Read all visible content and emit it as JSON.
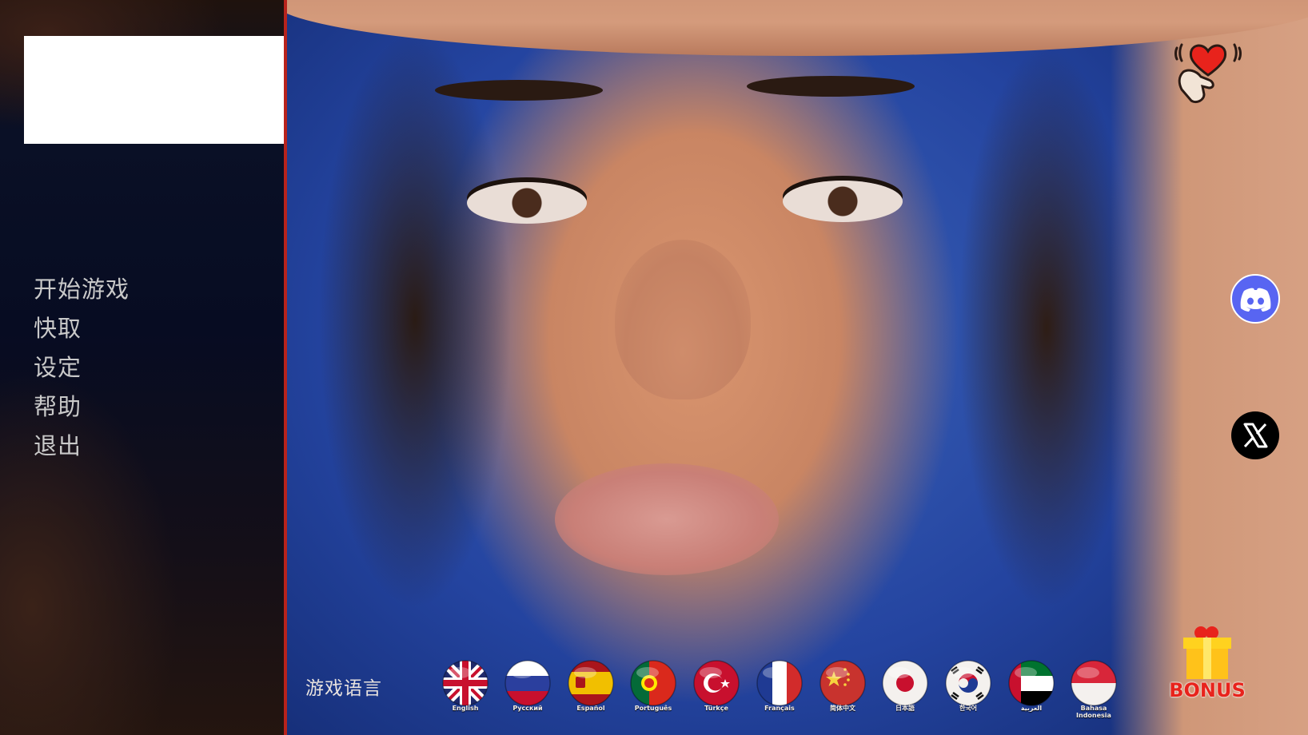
{
  "main_menu": {
    "items": [
      {
        "label": "开始游戏"
      },
      {
        "label": "快取"
      },
      {
        "label": "设定"
      },
      {
        "label": "帮助"
      },
      {
        "label": "退出"
      }
    ]
  },
  "language_bar": {
    "label": "游戏语言",
    "languages": [
      {
        "caption": "English",
        "icon": "uk-flag-icon"
      },
      {
        "caption": "Русский",
        "icon": "russia-flag-icon"
      },
      {
        "caption": "Español",
        "icon": "spain-flag-icon"
      },
      {
        "caption": "Português",
        "icon": "portugal-flag-icon"
      },
      {
        "caption": "Türkçe",
        "icon": "turkey-flag-icon"
      },
      {
        "caption": "Français",
        "icon": "france-flag-icon"
      },
      {
        "caption": "简体中文",
        "icon": "china-flag-icon"
      },
      {
        "caption": "日本語",
        "icon": "japan-flag-icon"
      },
      {
        "caption": "한국어",
        "icon": "korea-flag-icon"
      },
      {
        "caption": "العربية",
        "icon": "uae-flag-icon"
      },
      {
        "caption": "Bahasa Indonesia",
        "icon": "indonesia-flag-icon"
      }
    ]
  },
  "social": {
    "support_icon": "heart-hand-icon",
    "discord_icon": "discord-icon",
    "x_icon": "x-icon"
  },
  "bonus": {
    "label": "BONUS",
    "icon": "gift-icon"
  },
  "colors": {
    "accent_red": "#b8231c",
    "menu_text": "#c9c9c9",
    "discord_blue": "#5865f2",
    "bonus_red": "#e8231c"
  }
}
